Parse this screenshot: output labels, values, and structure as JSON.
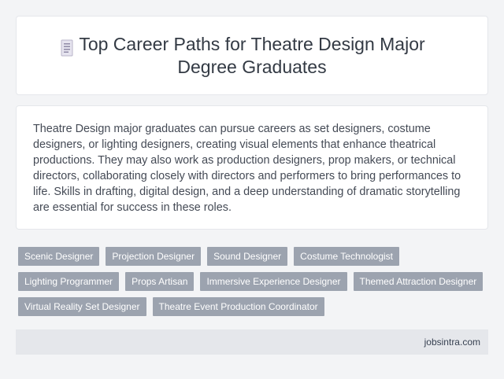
{
  "header": {
    "title": "Top Career Paths for Theatre Design Major Degree Graduates",
    "icon": "document-icon"
  },
  "description": "Theatre Design major graduates can pursue careers as set designers, costume designers, or lighting designers, creating visual elements that enhance theatrical productions. They may also work as production designers, prop makers, or technical directors, collaborating closely with directors and performers to bring performances to life. Skills in drafting, digital design, and a deep understanding of dramatic storytelling are essential for success in these roles.",
  "tags": [
    "Scenic Designer",
    "Projection Designer",
    "Sound Designer",
    "Costume Technologist",
    "Lighting Programmer",
    "Props Artisan",
    "Immersive Experience Designer",
    "Themed Attraction Designer",
    "Virtual Reality Set Designer",
    "Theatre Event Production Coordinator"
  ],
  "footer": {
    "site": "jobsintra.com"
  },
  "colors": {
    "background": "#f3f4f6",
    "tag": "#9ca3af",
    "footer": "#e5e7eb"
  }
}
